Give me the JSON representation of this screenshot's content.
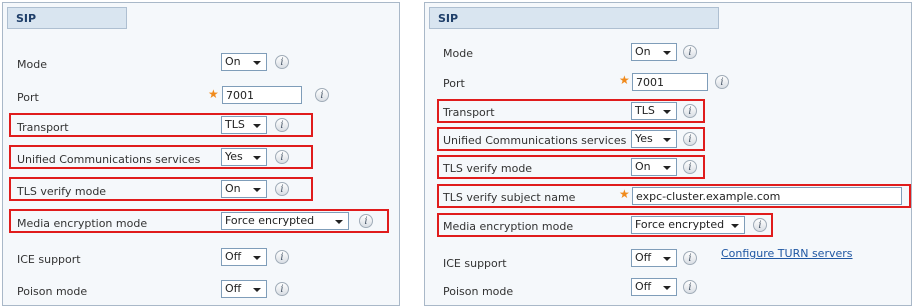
{
  "left": {
    "title": "SIP",
    "mode": {
      "label": "Mode",
      "value": "On"
    },
    "port": {
      "label": "Port",
      "value": "7001"
    },
    "transport": {
      "label": "Transport",
      "value": "TLS"
    },
    "ucs": {
      "label": "Unified Communications services",
      "value": "Yes"
    },
    "tls_verify": {
      "label": "TLS verify mode",
      "value": "On"
    },
    "media_enc": {
      "label": "Media encryption mode",
      "value": "Force encrypted"
    },
    "ice": {
      "label": "ICE support",
      "value": "Off"
    },
    "poison": {
      "label": "Poison mode",
      "value": "Off"
    }
  },
  "right": {
    "title": "SIP",
    "mode": {
      "label": "Mode",
      "value": "On"
    },
    "port": {
      "label": "Port",
      "value": "7001"
    },
    "transport": {
      "label": "Transport",
      "value": "TLS"
    },
    "ucs": {
      "label": "Unified Communications services",
      "value": "Yes"
    },
    "tls_verify": {
      "label": "TLS verify mode",
      "value": "On"
    },
    "tls_subject": {
      "label": "TLS verify subject name",
      "value": "expc-cluster.example.com"
    },
    "media_enc": {
      "label": "Media encryption mode",
      "value": "Force encrypted"
    },
    "ice": {
      "label": "ICE support",
      "value": "Off",
      "link": "Configure TURN servers"
    },
    "poison": {
      "label": "Poison mode",
      "value": "Off"
    }
  },
  "info_glyph": "i",
  "required_glyph": "★"
}
